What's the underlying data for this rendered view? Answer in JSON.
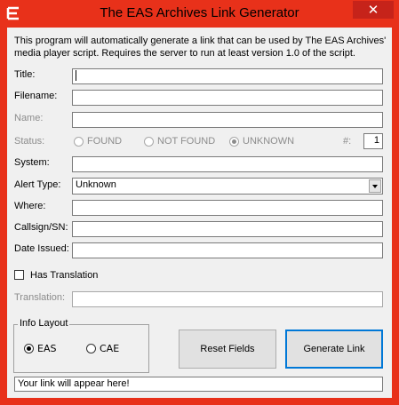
{
  "window": {
    "title": "The EAS Archives Link Generator",
    "close_glyph": "✕",
    "accent_color": "#e8311a"
  },
  "description": "This program will automatically generate a link that can be used by The EAS Archives' media player script. Requires the server to run at least version 1.0 of the script.",
  "fields": {
    "title": {
      "label": "Title:",
      "value": ""
    },
    "filename": {
      "label": "Filename:",
      "value": ""
    },
    "name": {
      "label": "Name:",
      "value": ""
    },
    "system": {
      "label": "System:",
      "value": ""
    },
    "where": {
      "label": "Where:",
      "value": ""
    },
    "callsign": {
      "label": "Callsign/SN:",
      "value": ""
    },
    "date_issued": {
      "label": "Date Issued:",
      "value": ""
    },
    "translation": {
      "label": "Translation:",
      "value": ""
    }
  },
  "status": {
    "label": "Status:",
    "options": [
      "FOUND",
      "NOT FOUND",
      "UNKNOWN"
    ],
    "selected": "UNKNOWN",
    "count_label": "#:",
    "count_value": "1"
  },
  "alert_type": {
    "label": "Alert Type:",
    "selected": "Unknown"
  },
  "has_translation": {
    "label": "Has Translation",
    "checked": false
  },
  "info_layout": {
    "title": "Info Layout",
    "options": [
      "EAS",
      "CAE"
    ],
    "selected": "EAS"
  },
  "buttons": {
    "reset": "Reset Fields",
    "generate": "Generate Link"
  },
  "output": "Your link will appear here!"
}
